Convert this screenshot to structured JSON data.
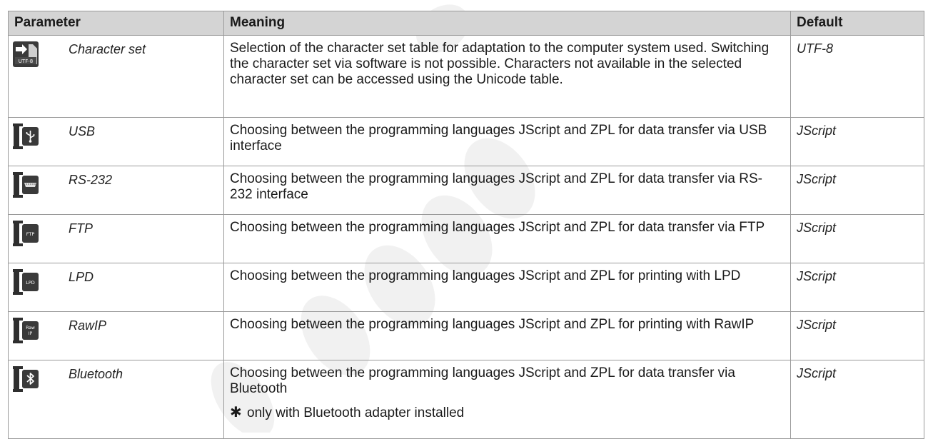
{
  "headers": {
    "parameter": "Parameter",
    "meaning": "Meaning",
    "default": "Default"
  },
  "rows": [
    {
      "icon": "character-set-utf8-icon",
      "icon_text": "UTF-8",
      "name": "Character set",
      "meaning": "Selection of the character set table for adaptation to the computer system used. Switching the character set via software is not possible. Characters not available in the selected character set can be accessed using the Unicode table.",
      "default": "UTF-8"
    },
    {
      "icon": "usb-interface-icon",
      "icon_text": "",
      "name": "USB",
      "meaning": "Choosing between the programming languages JScript and ZPL for data transfer via USB interface",
      "default": "JScript"
    },
    {
      "icon": "rs232-interface-icon",
      "icon_text": "",
      "name": "RS-232",
      "meaning": "Choosing between the programming languages JScript and ZPL for data transfer via RS-232 interface",
      "default": "JScript"
    },
    {
      "icon": "ftp-interface-icon",
      "icon_text": "FTP",
      "name": "FTP",
      "meaning": "Choosing between the programming languages JScript and ZPL for data transfer via FTP",
      "default": "JScript"
    },
    {
      "icon": "lpd-interface-icon",
      "icon_text": "LPD",
      "name": "LPD",
      "meaning": "Choosing between the programming languages JScript and ZPL for printing with LPD",
      "default": "JScript"
    },
    {
      "icon": "rawip-interface-icon",
      "icon_text": "Raw IP",
      "name": "RawIP",
      "meaning": "Choosing between the programming languages JScript and ZPL for printing with RawIP",
      "default": "JScript"
    },
    {
      "icon": "bluetooth-interface-icon",
      "icon_text": "",
      "name": "Bluetooth",
      "meaning": "Choosing between the programming languages JScript and  ZPL for data transfer via Bluetooth",
      "default": "JScript",
      "note_symbol": "✱",
      "note": "only with Bluetooth adapter installed"
    }
  ],
  "watermark_color": "#f2f2f2"
}
